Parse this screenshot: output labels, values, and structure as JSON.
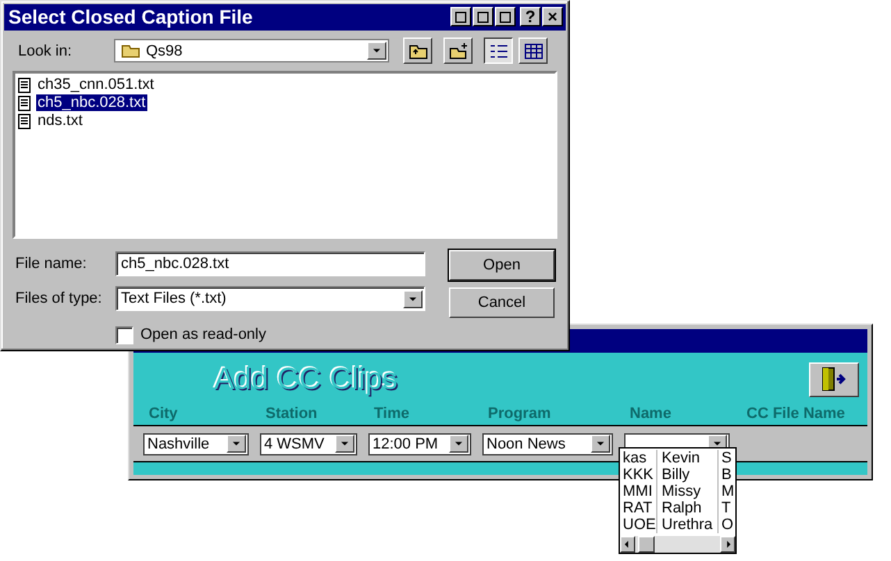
{
  "dialog": {
    "title": "Select Closed Caption File",
    "title_buttons": [
      {
        "kind": "icon"
      },
      {
        "kind": "icon"
      },
      {
        "kind": "icon"
      },
      {
        "kind": "help",
        "label": "?"
      },
      {
        "kind": "close",
        "label": "×"
      }
    ],
    "look_in": {
      "label": "Look in:",
      "value": "Qs98"
    },
    "files": [
      {
        "name": "ch35_cnn.051.txt",
        "selected": false
      },
      {
        "name": "ch5_nbc.028.txt",
        "selected": true
      },
      {
        "name": "nds.txt",
        "selected": false
      }
    ],
    "file_name": {
      "label": "File name:",
      "value": "ch5_nbc.028.txt"
    },
    "file_type": {
      "label": "Files of type:",
      "value": "Text Files (*.txt)"
    },
    "read_only": {
      "label": "Open as read-only",
      "checked": false
    },
    "buttons": [
      "Open",
      "Cancel"
    ]
  },
  "app": {
    "title": "Add CC Clips",
    "columns": [
      "City",
      "Station",
      "Time",
      "Program",
      "Name",
      "CC File Name"
    ],
    "fields": [
      {
        "value": "Nashville"
      },
      {
        "value": "4 WSMV"
      },
      {
        "value": "12:00 PM"
      },
      {
        "value": "Noon News"
      }
    ],
    "name_field": {
      "expanded": true
    },
    "name_list": [
      {
        "code": "kas",
        "name": "Kevin",
        "extra": "S"
      },
      {
        "code": "KKK",
        "name": "Billy",
        "extra": "B"
      },
      {
        "code": "MMI",
        "name": "Missy",
        "extra": "M"
      },
      {
        "code": "RAT",
        "name": "Ralph",
        "extra": "T"
      },
      {
        "code": "UOE",
        "name": "Urethra",
        "extra": "O"
      }
    ]
  }
}
